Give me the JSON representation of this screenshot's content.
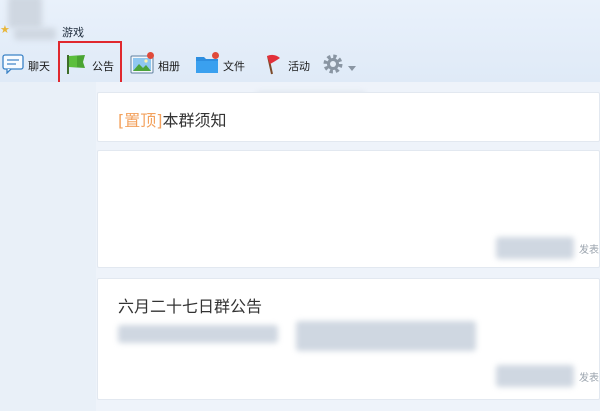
{
  "header": {
    "game_link": "游戏"
  },
  "toolbar": {
    "items": [
      {
        "label": "聊天"
      },
      {
        "label": "公告"
      },
      {
        "label": "相册"
      },
      {
        "label": "文件"
      },
      {
        "label": "活动"
      }
    ]
  },
  "feed": {
    "pinned": {
      "tag": "[置顶]",
      "title": "本群须知"
    },
    "posts": [
      {
        "title": "",
        "meta": "发表"
      },
      {
        "title": "六月二十七日群公告",
        "meta": "发表"
      }
    ]
  },
  "colors": {
    "highlight": "#e0282e",
    "pinned_tag": "#f3a25e",
    "accent_blue": "#2d8ee0"
  }
}
